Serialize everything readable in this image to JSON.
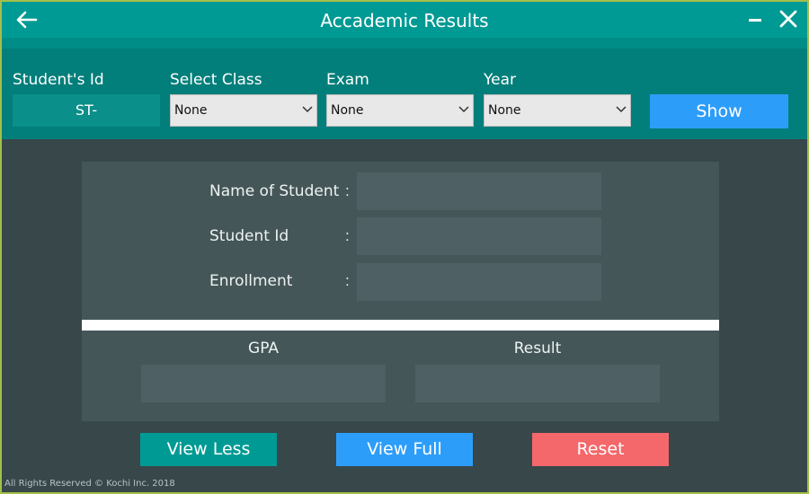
{
  "window": {
    "title": "Accademic Results"
  },
  "filters": {
    "student_id_label": "Student's Id",
    "student_id_value": "ST-",
    "class_label": "Select Class",
    "class_value": "None",
    "exam_label": "Exam",
    "exam_value": "None",
    "year_label": "Year",
    "year_value": "None",
    "show_label": "Show"
  },
  "details": {
    "name_label": "Name of Student",
    "id_label": "Student Id",
    "enrollment_label": "Enrollment",
    "colon": ":",
    "gpa_label": "GPA",
    "result_label": "Result"
  },
  "actions": {
    "view_less": "View Less",
    "view_full": "View Full",
    "reset": "Reset"
  },
  "footer": {
    "text": "All Rights Reserved © Kochi Inc. 2018"
  },
  "icons": {
    "back": "arrow-left-icon",
    "minimize": "minimize-icon",
    "close": "close-icon",
    "dropdown": "chevron-down-icon"
  },
  "colors": {
    "titlebar": "#009a94",
    "filterbar": "#027f7b",
    "background": "#37474a",
    "card": "#455658",
    "show": "#2d9dfa",
    "view_less": "#009a94",
    "view_full": "#2d9dfa",
    "reset": "#f4676a"
  }
}
